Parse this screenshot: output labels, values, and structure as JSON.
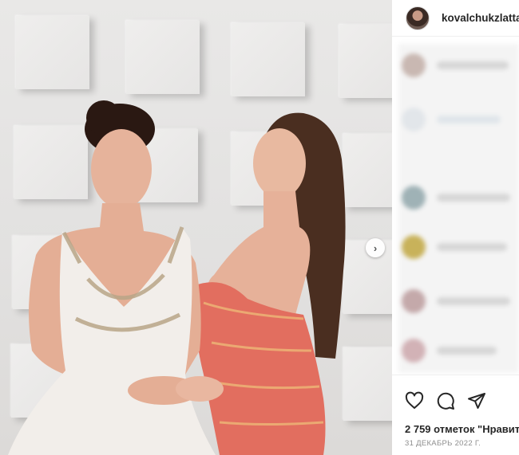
{
  "post": {
    "username": "kovalchukzlatta",
    "likes_text": "2 759 отметок \"Нравит",
    "date_text": "31 ДЕКАБРЬ 2022 Г."
  },
  "icons": {
    "like": "heart-icon",
    "comment": "comment-icon",
    "share": "share-icon",
    "next": "chevron-right-icon"
  },
  "colors": {
    "text_primary": "#262626",
    "text_secondary": "#8e8e8e",
    "border": "#efefef"
  }
}
